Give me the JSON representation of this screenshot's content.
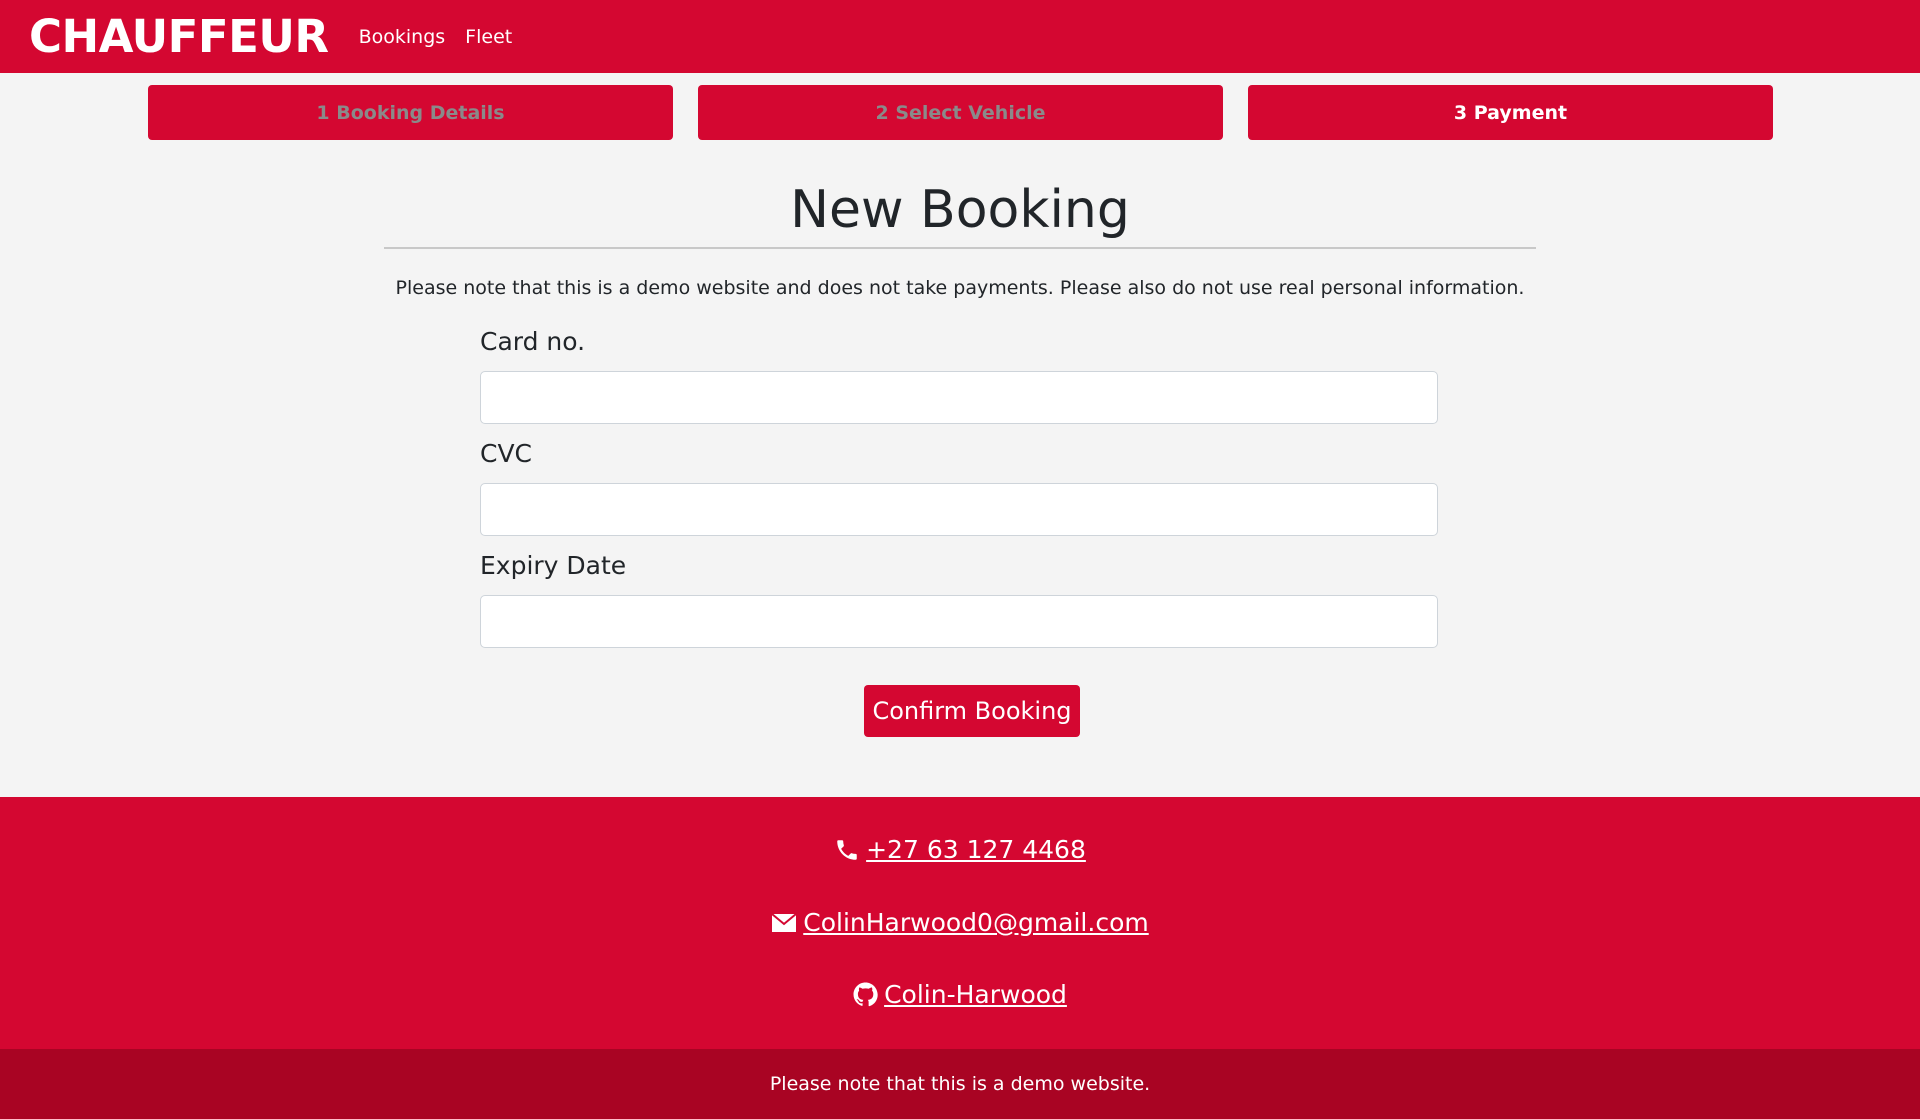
{
  "navbar": {
    "brand": "CHAUFFEUR",
    "links": [
      "Bookings",
      "Fleet"
    ]
  },
  "steps": [
    {
      "label": "1 Booking Details",
      "active": false
    },
    {
      "label": "2 Select Vehicle",
      "active": false
    },
    {
      "label": "3 Payment",
      "active": true
    }
  ],
  "main": {
    "title": "New Booking",
    "note": "Please note that this is a demo website and does not take payments. Please also do not use real personal information.",
    "fields": [
      {
        "label": "Card no.",
        "value": "",
        "placeholder": ""
      },
      {
        "label": "CVC",
        "value": "",
        "placeholder": ""
      },
      {
        "label": "Expiry Date",
        "value": "",
        "placeholder": ""
      }
    ],
    "confirm_label": "Confirm Booking"
  },
  "footer": {
    "phone": "+27 63 127 4468",
    "email": "ColinHarwood0@gmail.com",
    "github": "Colin-Harwood",
    "icons": [
      "phone-icon",
      "envelope-icon",
      "github-icon"
    ],
    "bottom_note": "Please note that this is a demo website."
  },
  "colors": {
    "brand": "#d40731",
    "footer_bottom": "#a90423",
    "background": "#f4f4f4"
  }
}
